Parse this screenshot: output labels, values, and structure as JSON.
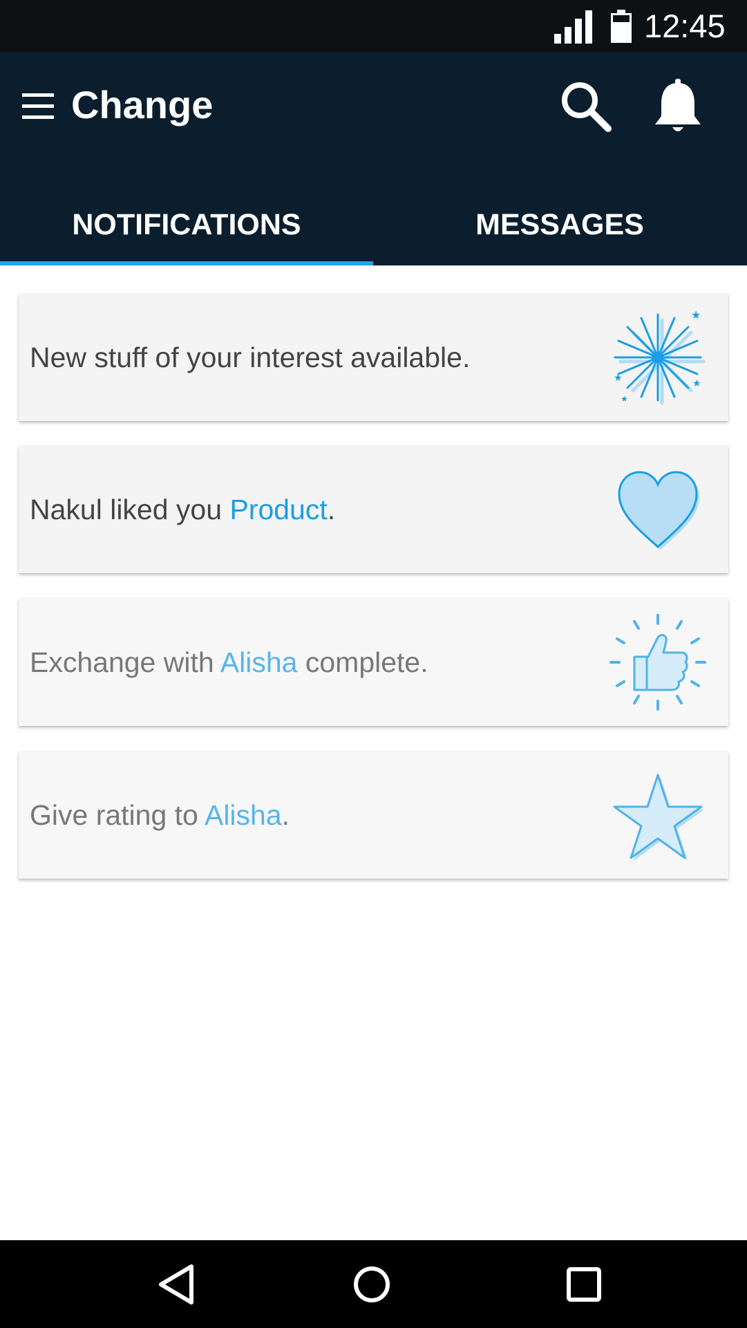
{
  "status_bar": {
    "time": "12:45",
    "icons": [
      "signal-icon",
      "battery-icon"
    ]
  },
  "app_bar": {
    "title": "Change",
    "icons": [
      "menu-icon",
      "search-icon",
      "bell-icon"
    ]
  },
  "tabs": [
    {
      "label": "NOTIFICATIONS",
      "selected": true
    },
    {
      "label": "MESSAGES",
      "selected": false
    }
  ],
  "notifications": [
    {
      "text_before": "New stuff of your interest available.",
      "link": "",
      "text_after": "",
      "icon": "fireworks-icon",
      "read": false
    },
    {
      "text_before": "Nakul liked you ",
      "link": "Product",
      "text_after": ".",
      "icon": "heart-icon",
      "read": false
    },
    {
      "text_before": "Exchange with ",
      "link": "Alisha",
      "text_after": " complete.",
      "icon": "thumbs-up-icon",
      "read": true
    },
    {
      "text_before": "Give rating to ",
      "link": "Alisha",
      "text_after": ".",
      "icon": "star-icon",
      "read": true
    }
  ],
  "nav_bar": {
    "icons": [
      "back-icon",
      "home-icon",
      "recent-apps-icon"
    ]
  },
  "colors": {
    "app_bar": "#0b1e2d",
    "status_bar": "#0d1114",
    "accent": "#29a3ea",
    "link": "#1a9ee6",
    "card": "#f4f4f4"
  }
}
